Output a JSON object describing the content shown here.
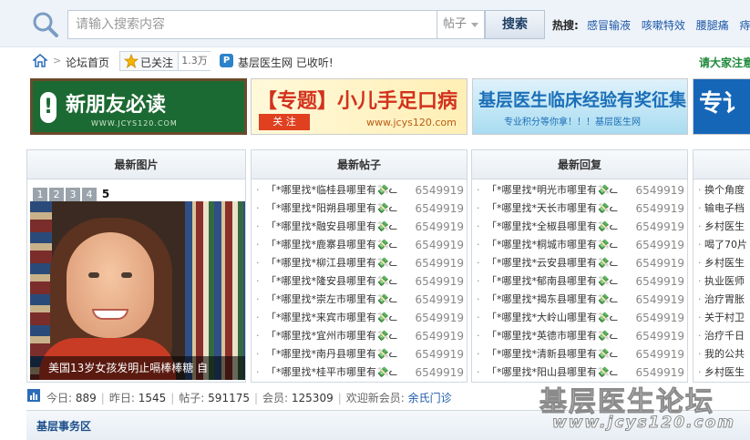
{
  "search": {
    "placeholder": "请输入搜索内容",
    "type_selected": "帖子",
    "button_label": "搜索",
    "hot_label": "热搜:",
    "hot_links": [
      "感冒输液",
      "咳嗽特效",
      "腰腿痛",
      "痔疮"
    ]
  },
  "nav": {
    "sep": ">",
    "home_label": "论坛首页",
    "follow_label": "已关注",
    "follow_count": "1.3万",
    "collect_text": "基层医生网 已收听!",
    "notice": "请大家注意"
  },
  "banners": {
    "b1_title": "新朋友必读",
    "b1_sub": "WWW.JCYS120.COM",
    "b2_title": "【专题】小儿手足口病",
    "b2_tag": "关 注",
    "b2_url": "www.jcys120.com",
    "b3_title": "基层医生临床经验有奖征集",
    "b3_sub": "专业积分等你拿！！！基层医生网",
    "b4_title": "专讠"
  },
  "panels": {
    "pics": {
      "header": "最新图片",
      "pages": [
        "1",
        "2",
        "3",
        "4",
        "5"
      ],
      "caption": "美国13岁女孩发明止嗝棒棒糖 自"
    },
    "posts": {
      "header": "最新帖子",
      "items": [
        {
          "title": "「*哪里找*临桂县哪里有💸ᓚ",
          "num": "6549919"
        },
        {
          "title": "「*哪里找*阳朔县哪里有💸ᓚ",
          "num": "6549919"
        },
        {
          "title": "「*哪里找*融安县哪里有💸ᓚ",
          "num": "6549919"
        },
        {
          "title": "「*哪里找*鹿寨县哪里有💸ᓚ",
          "num": "6549919"
        },
        {
          "title": "「*哪里找*柳江县哪里有💸ᓚ",
          "num": "6549919"
        },
        {
          "title": "「*哪里找*隆安县哪里有💸ᓚ",
          "num": "6549919"
        },
        {
          "title": "「*哪里找*崇左市哪里有💸ᓚ",
          "num": "6549919"
        },
        {
          "title": "「*哪里找*来宾市哪里有💸ᓚ",
          "num": "6549919"
        },
        {
          "title": "「*哪里找*宜州市哪里有💸ᓚ",
          "num": "6549919"
        },
        {
          "title": "「*哪里找*南丹县哪里有💸ᓚ",
          "num": "6549919"
        },
        {
          "title": "「*哪里找*桂平市哪里有💸ᓚ",
          "num": "6549919"
        }
      ]
    },
    "replies": {
      "header": "最新回复",
      "items": [
        {
          "title": "「*哪里找*明光市哪里有💸ᓚ",
          "num": "6549919"
        },
        {
          "title": "「*哪里找*天长市哪里有💸ᓚ",
          "num": "6549919"
        },
        {
          "title": "「*哪里找*全椒县哪里有💸ᓚ",
          "num": "6549919"
        },
        {
          "title": "「*哪里找*桐城市哪里有💸ᓚ",
          "num": "6549919"
        },
        {
          "title": "「*哪里找*云安县哪里有💸ᓚ",
          "num": "6549919"
        },
        {
          "title": "「*哪里找*郁南县哪里有💸ᓚ",
          "num": "6549919"
        },
        {
          "title": "「*哪里找*揭东县哪里有💸ᓚ",
          "num": "6549919"
        },
        {
          "title": "「*哪里找*大岭山哪里有💸ᓚ",
          "num": "6549919"
        },
        {
          "title": "「*哪里找*英德市哪里有💸ᓚ",
          "num": "6549919"
        },
        {
          "title": "「*哪里找*清新县哪里有💸ᓚ",
          "num": "6549919"
        },
        {
          "title": "「*哪里找*阳山县哪里有💸ᓚ",
          "num": "6549919"
        }
      ]
    },
    "right": {
      "header": "",
      "items": [
        "换个角度",
        "输电子档",
        "乡村医生",
        "喝了70片",
        "乡村医生",
        "执业医师",
        "治疗胃胀",
        "关于村卫",
        "治疗千日",
        "我的公共",
        "乡村医生"
      ]
    }
  },
  "stats": {
    "today_label": "今日:",
    "today": "889",
    "yesterday_label": "昨日:",
    "yesterday": "1545",
    "posts_label": "帖子:",
    "posts": "591175",
    "members_label": "会员:",
    "members": "125309",
    "welcome_label": "欢迎新会员:",
    "new_member": "余氏门诊"
  },
  "section": {
    "title": "基层事务区"
  },
  "watermark": {
    "cn": "基层医生论坛",
    "url": "www.jcys120.com"
  }
}
